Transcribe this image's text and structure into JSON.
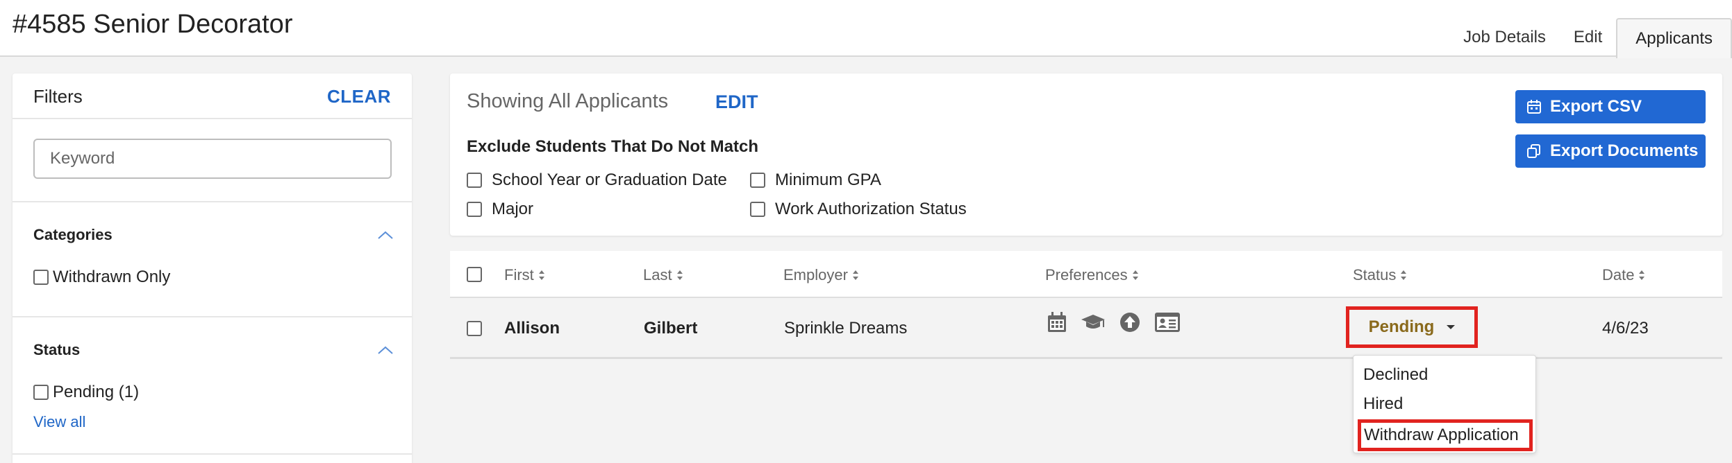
{
  "header": {
    "title": "#4585 Senior Decorator",
    "tabs": [
      {
        "label": "Job Details"
      },
      {
        "label": "Edit"
      },
      {
        "label": "Applicants"
      }
    ]
  },
  "sidebar": {
    "title": "Filters",
    "clear_label": "CLEAR",
    "keyword_placeholder": "Keyword",
    "categories": {
      "title": "Categories",
      "options": [
        "Withdrawn Only"
      ]
    },
    "status": {
      "title": "Status",
      "options": [
        "Pending (1)"
      ],
      "view_all": "View all"
    }
  },
  "panel": {
    "showing": "Showing All Applicants",
    "edit_label": "EDIT",
    "exclude_title": "Exclude Students That Do Not Match",
    "filters": [
      "School Year or Graduation Date",
      "Minimum GPA",
      "Major",
      "Work Authorization Status"
    ],
    "export_csv": "Export CSV",
    "export_documents": "Export Documents"
  },
  "table": {
    "columns": [
      "First",
      "Last",
      "Employer",
      "Preferences",
      "Status",
      "Date"
    ],
    "rows": [
      {
        "first": "Allison",
        "last": "Gilbert",
        "employer": "Sprinkle Dreams",
        "preferences": [
          "calendar-icon",
          "graduation-cap-icon",
          "upload-icon",
          "id-card-icon"
        ],
        "status": "Pending",
        "date": "4/6/23"
      }
    ]
  },
  "status_dropdown": {
    "options": [
      "Declined",
      "Hired",
      "Withdraw Application"
    ]
  },
  "colors": {
    "accent": "#1f66c7",
    "button": "#2168d3",
    "highlight": "#e1231f",
    "pending": "#8a6a1c"
  }
}
